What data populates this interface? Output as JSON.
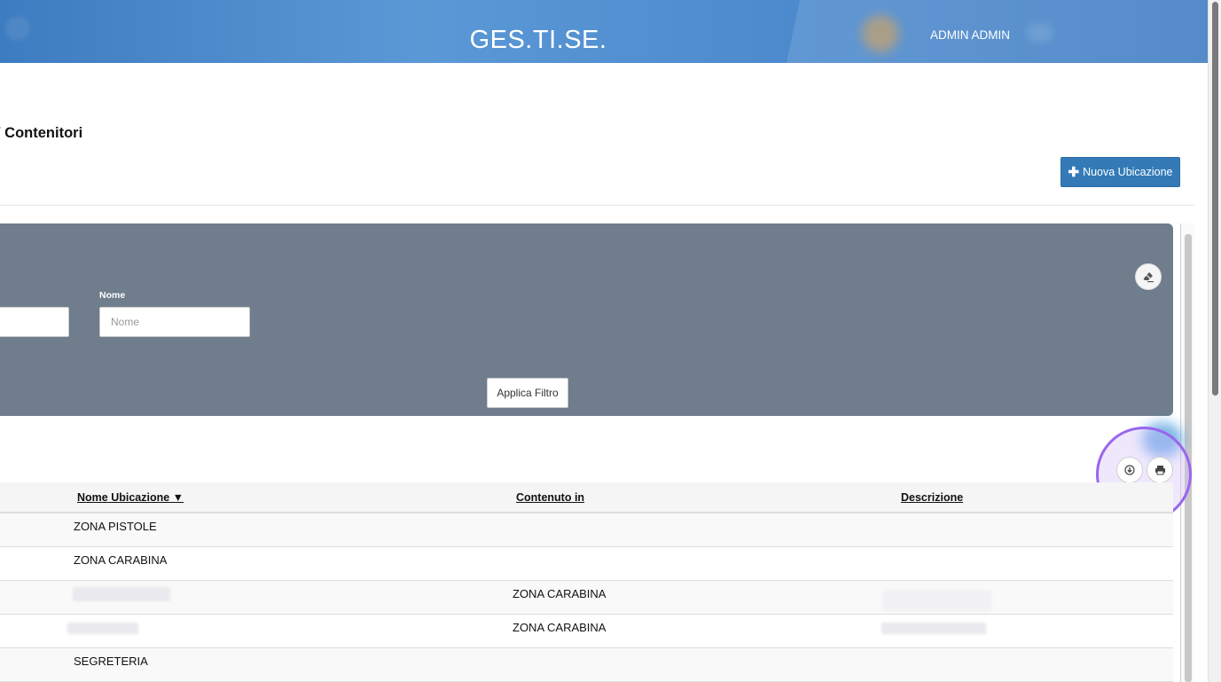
{
  "header": {
    "app_title": "GES.TI.SE.",
    "user_name": "ADMIN ADMIN"
  },
  "page": {
    "title": "/ Contenitori",
    "new_button_label": "Nuova Ubicazione"
  },
  "filter": {
    "nome_label": "Nome",
    "nome_placeholder": "Nome",
    "apply_label": "Applica Filtro"
  },
  "table": {
    "columns": [
      "Nome Ubicazione ▼",
      "Contenuto in",
      "Descrizione"
    ],
    "rows": [
      {
        "nome": "ZONA PISTOLE",
        "contenuto": "",
        "descrizione": ""
      },
      {
        "nome": "ZONA CARABINA",
        "contenuto": "",
        "descrizione": ""
      },
      {
        "nome": "",
        "contenuto": "ZONA CARABINA",
        "descrizione": ""
      },
      {
        "nome": "",
        "contenuto": "ZONA CARABINA",
        "descrizione": ""
      },
      {
        "nome": "SEGRETERIA",
        "contenuto": "",
        "descrizione": ""
      }
    ]
  },
  "colors": {
    "header_blue": "#4a88cc",
    "filter_panel": "#6f7d8c",
    "primary_button": "#337ab7",
    "highlight_ring": "#9966ee"
  },
  "icons": {
    "eraser": "eraser-icon",
    "download": "download-icon",
    "print": "print-icon",
    "plus": "plus-icon"
  }
}
